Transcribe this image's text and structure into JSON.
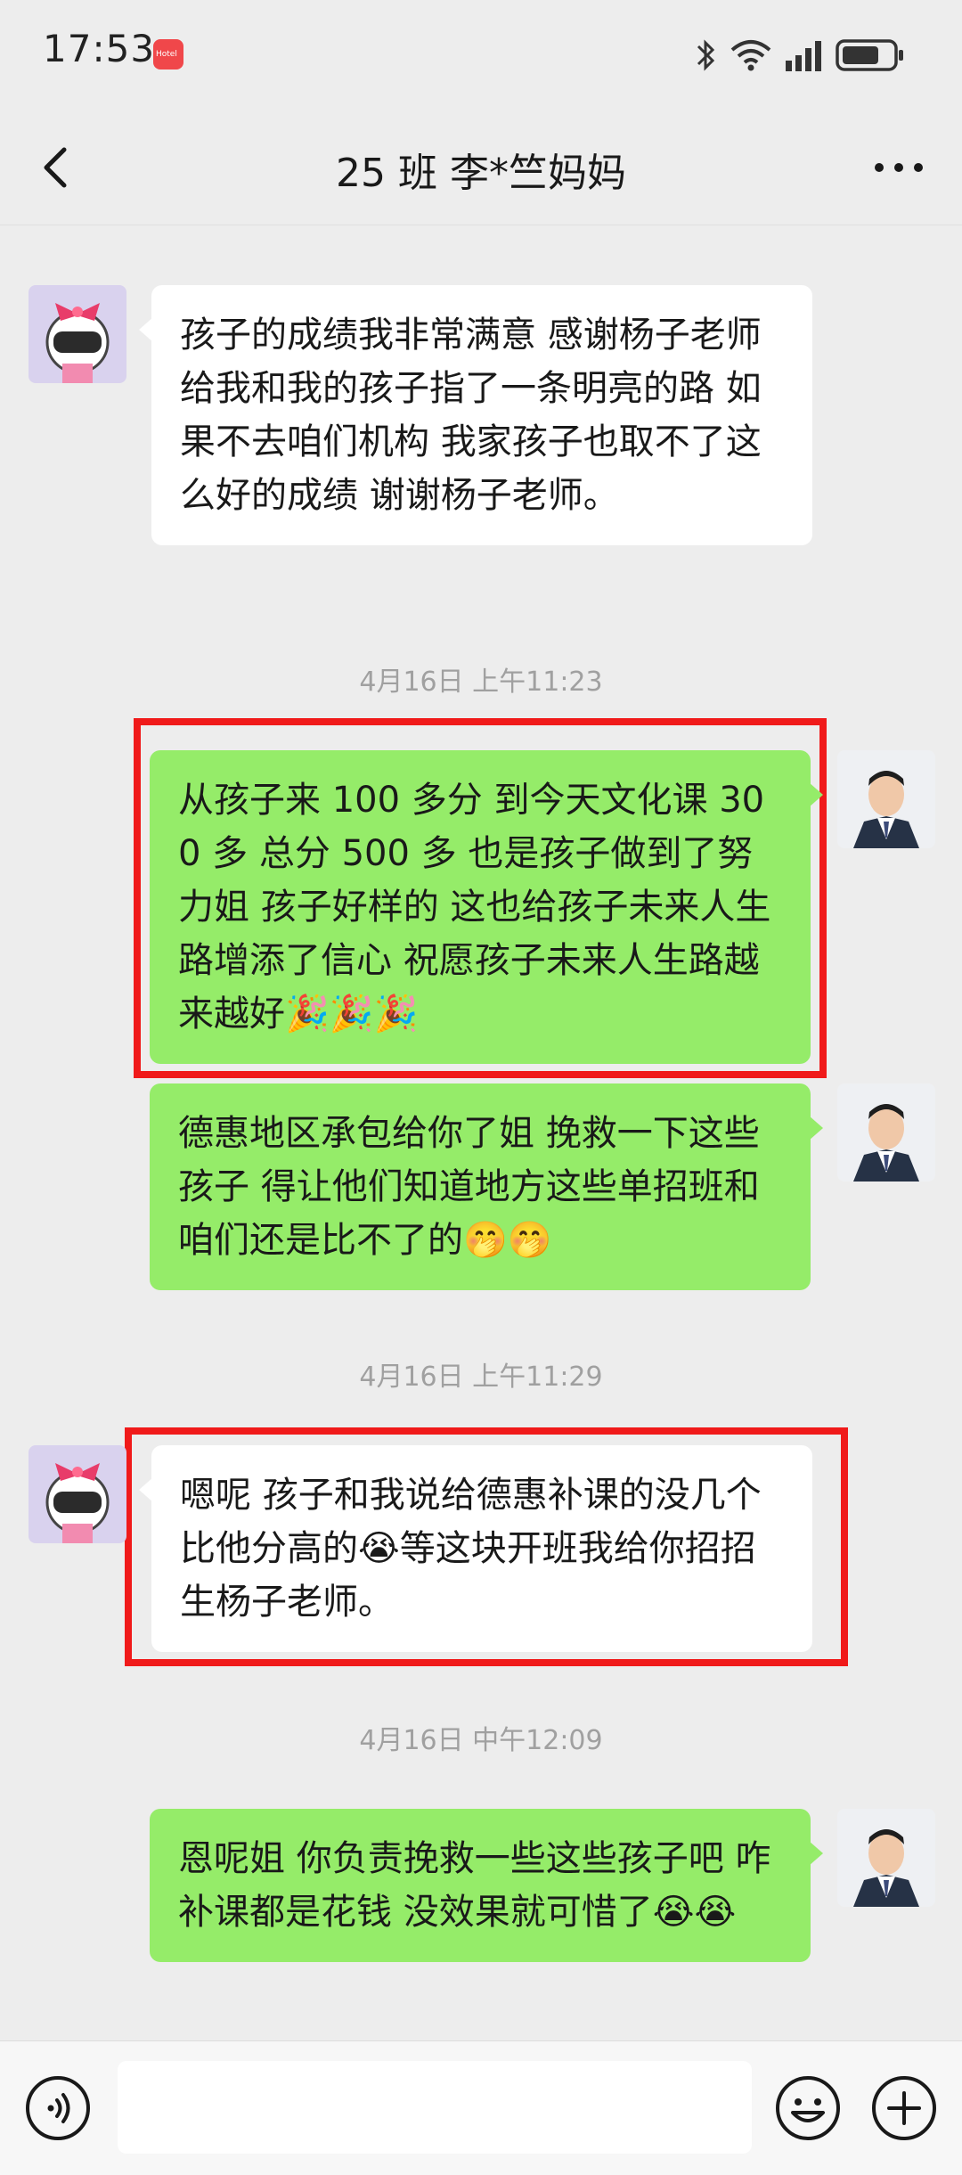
{
  "status_bar": {
    "time": "17:53",
    "app_badge_text": "Hotel"
  },
  "header": {
    "title": "25 班 李*竺妈妈"
  },
  "icons": {
    "back": "chevron-left-icon",
    "more": "more-dots-icon",
    "voice": "voice-icon",
    "emoji": "emoji-icon",
    "add": "plus-icon"
  },
  "messages": [
    {
      "side": "in",
      "text": "孩子的成绩我非常满意 感谢杨子老师给我和我的孩子指了一条明亮的路 如果不去咱们机构 我家孩子也取不了这么好的成绩 谢谢杨子老师。"
    },
    {
      "timestamp": "4月16日 上午11:23"
    },
    {
      "side": "out",
      "text": "从孩子来 100 多分 到今天文化课 300 多 总分 500 多 也是孩子做到了努力姐 孩子好样的 这也给孩子未来人生路增添了信心 祝愿孩子未来人生路越来越好🎉🎉🎉"
    },
    {
      "side": "out",
      "text": "德惠地区承包给你了姐 挽救一下这些孩子 得让他们知道地方这些单招班和咱们还是比不了的🤭🤭"
    },
    {
      "timestamp": "4月16日 上午11:29"
    },
    {
      "side": "in",
      "text": "嗯呢 孩子和我说给德惠补课的没几个比他分高的😭等这块开班我给你招招生杨子老师。"
    },
    {
      "timestamp": "4月16日 中午12:09"
    },
    {
      "side": "out",
      "text": "恩呢姐 你负责挽救一些这些孩子吧 咋补课都是花钱 没效果就可惜了😭😭"
    }
  ],
  "colors": {
    "highlight": "#f01a1a",
    "out_bubble": "#95ec69",
    "in_bubble": "#ffffff",
    "background": "#ededed"
  }
}
